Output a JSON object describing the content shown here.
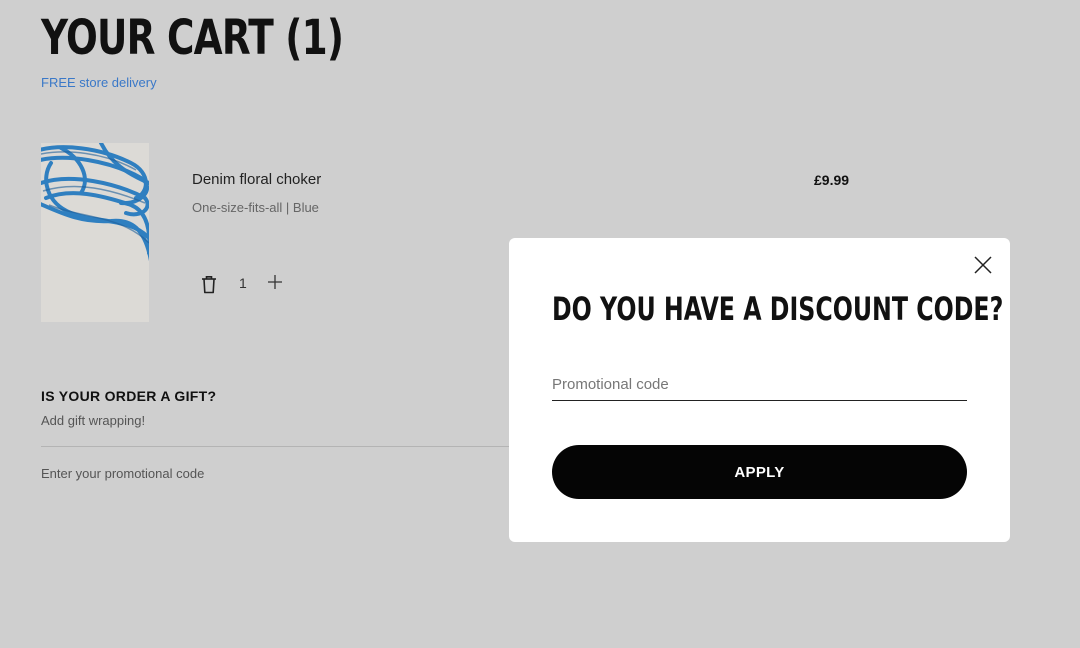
{
  "cart": {
    "title": "YOUR CART (1)",
    "delivery_link": "FREE store delivery",
    "item": {
      "name": "Denim floral choker",
      "variant": "One-size-fits-all | Blue",
      "price": "£9.99",
      "quantity": "1",
      "image_icon": "blue-cord-choker-photo"
    },
    "gift": {
      "title": "IS YOUR ORDER A GIFT?",
      "subtitle": "Add gift wrapping!"
    },
    "promo_link": "Enter your promotional code"
  },
  "modal": {
    "title": "DO YOU HAVE A DISCOUNT CODE?",
    "input_placeholder": "Promotional code",
    "input_value": "",
    "apply_label": "APPLY",
    "close_icon": "close-icon"
  },
  "colors": {
    "overlay_background": "#cfcfcf",
    "link": "#3a78c8",
    "primary_button": "#050505",
    "modal_background": "#ffffff"
  }
}
